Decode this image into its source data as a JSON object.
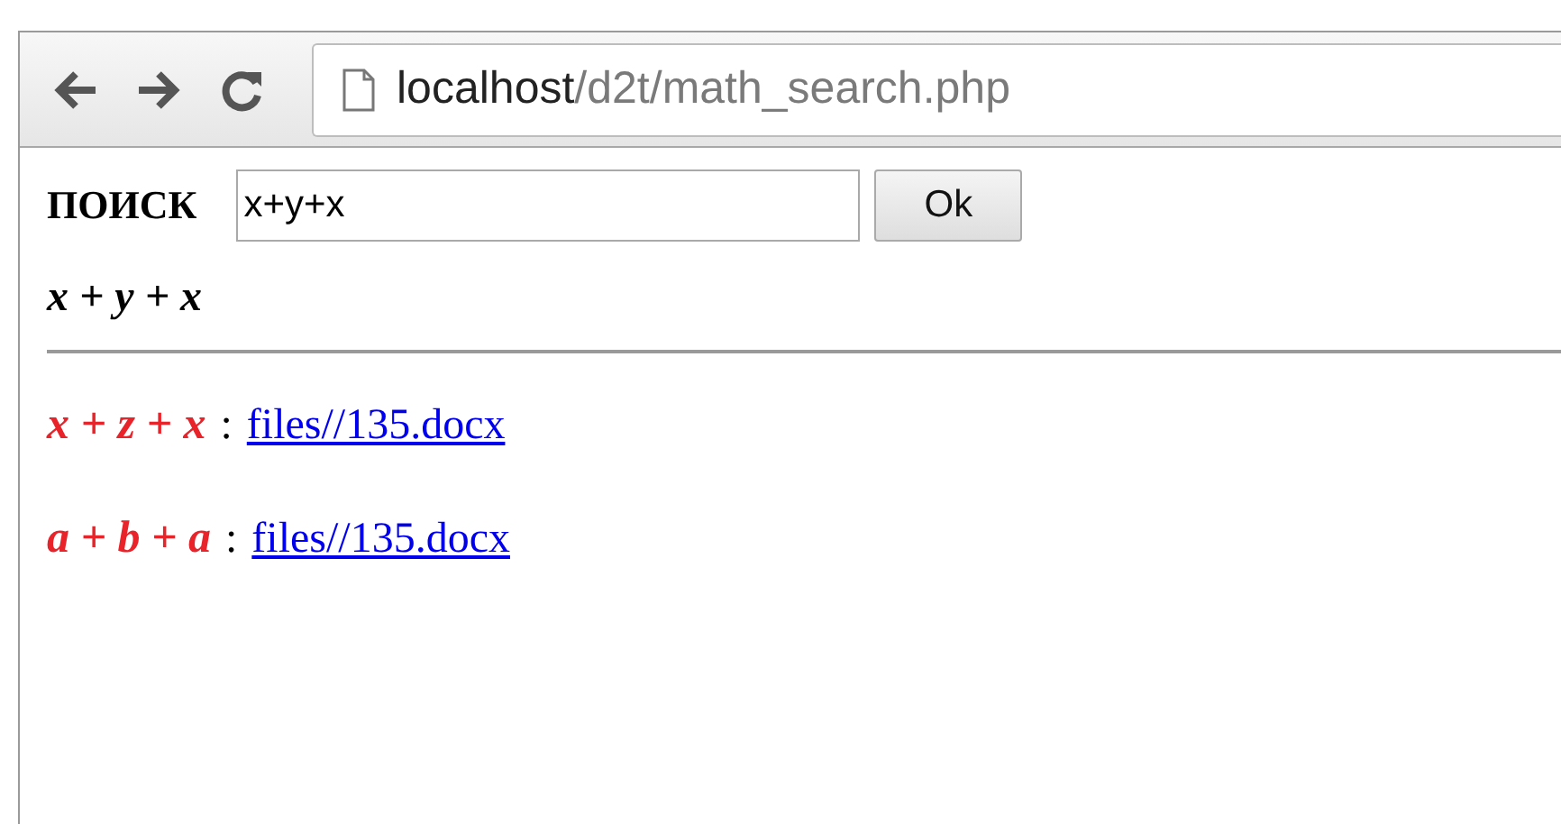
{
  "toolbar": {
    "address": {
      "host": "localhost",
      "path": "/d2t/math_search.php"
    }
  },
  "search": {
    "label": "ПОИСК",
    "value": "x+y+x",
    "button": "Ok"
  },
  "query_formula": "x + y + x",
  "results": [
    {
      "formula": "x + z + x",
      "separator": ":",
      "link": "files//135.docx"
    },
    {
      "formula": "a + b + a",
      "separator": ":",
      "link": "files//135.docx"
    }
  ]
}
